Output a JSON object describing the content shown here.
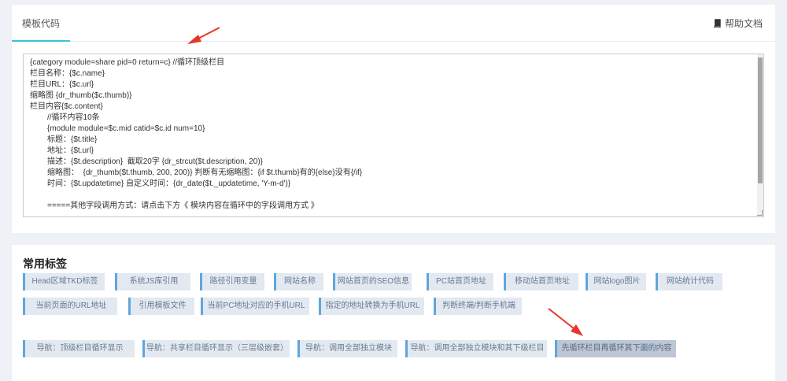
{
  "tabs": {
    "active_label": "模板代码"
  },
  "help": {
    "label": "帮助文档"
  },
  "code_lines": [
    "{category module=share pid=0 return=c} //循环顶级栏目",
    "栏目名称：{$c.name}",
    "栏目URL：{$c.url}",
    "缩略图 {dr_thumb($c.thumb)}",
    "栏目内容{$c.content}",
    "//循环内容10条",
    "{module module=$c.mid catid=$c.id num=10}",
    "标题：{$t.title}",
    "地址：{$t.url}",
    "描述：{$t.description}  截取20字 {dr_strcut($t.description, 20)}",
    "缩略图：  {dr_thumb($t.thumb, 200, 200)} 判断有无缩略图：{if $t.thumb}有的{else}没有{/if}",
    "时间：{$t.updatetime} 自定义时间：{dr_date($t._updatetime, 'Y-m-d')}",
    "",
    "=====其他字段调用方式：请点击下方《 模块内容在循环中的字段调用方式 》"
  ],
  "section": {
    "title": "常用标签"
  },
  "tags_row1": [
    "Head区域TKD标签",
    "系统JS库引用",
    "路径引用变量",
    "网站名称",
    "网站首页的SEO信息",
    "PC站首页地址",
    "移动站首页地址",
    "网站logo图片",
    "网站统计代码"
  ],
  "tags_row2": [
    "当前页面的URL地址",
    "引用模板文件",
    "当前PC地址对应的手机URL",
    "指定的地址转换为手机URL",
    "判断终端/判断手机端"
  ],
  "tags_row3": [
    "导航：顶级栏目循环显示",
    "导航：共享栏目循环显示（三层级嵌套）",
    "导航：调用全部独立模块",
    "导航：调用全部独立模块和其下级栏目",
    "先循环栏目再循环其下面的内容"
  ],
  "colors": {
    "tab_accent": "#36c6d3",
    "tag_border": "#5fa6dc",
    "tag_bg": "#e2e9f1",
    "tag_active_bg": "#bcc6d6",
    "arrow": "#e8352b"
  }
}
